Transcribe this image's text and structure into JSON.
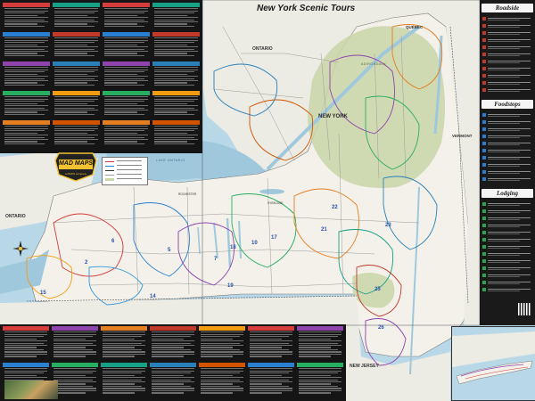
{
  "map": {
    "title": "New York Scenic Tours",
    "labels": {
      "ontario_top": "ONTARIO",
      "new_york": "NEW YORK",
      "vermont": "VERMONT",
      "quebec": "QUÉBEC",
      "ontario_west": "ONTARIO",
      "new_jersey": "NEW JERSEY",
      "adirondack": "ADIRONDACK",
      "lake_ontario": "LAKE ONTARIO",
      "syracuse": "SYRACUSE",
      "rochester": "ROCHESTER"
    },
    "tour_numbers": [
      "2",
      "5",
      "6",
      "7",
      "10",
      "14",
      "15",
      "17",
      "18",
      "19",
      "21",
      "22",
      "23",
      "25",
      "26",
      "30"
    ]
  },
  "logo": {
    "brand": "MAD MAPS",
    "tagline": "a MAPS company"
  },
  "sidebar": {
    "headings": {
      "attractions": "Roadside Attractions",
      "foodstops": "Foodstops",
      "lodging": "Lodging"
    },
    "colors": {
      "attractions": "#c0392b",
      "foodstops": "#2b7bd1",
      "lodging": "#2ea44f"
    }
  },
  "colors": {
    "land": "#f1efe8",
    "park": "#c9d6a8",
    "water": "#b8d8e8",
    "panel": "#151515",
    "border": "#4d5158"
  }
}
